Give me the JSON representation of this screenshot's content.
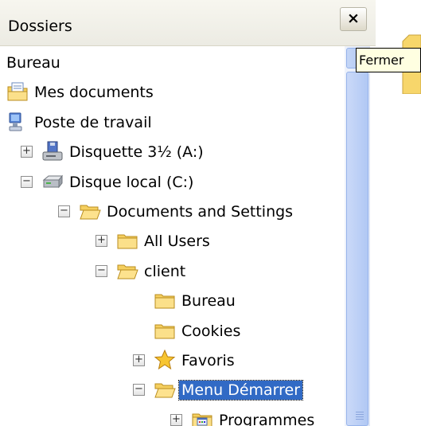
{
  "pane": {
    "title": "Dossiers",
    "close_label": "×"
  },
  "tooltip": {
    "text": "Fermer"
  },
  "tree": [
    {
      "label": "Bureau",
      "indent": 0,
      "expander": "",
      "icon": ""
    },
    {
      "label": "Mes documents",
      "indent": 0,
      "expander": "",
      "icon": "my-documents-icon"
    },
    {
      "label": "Poste de travail",
      "indent": 0,
      "expander": "",
      "icon": "my-computer-icon"
    },
    {
      "label": "Disquette 3½ (A:)",
      "indent": 1,
      "expander": "+",
      "icon": "floppy-drive-icon"
    },
    {
      "label": "Disque local (C:)",
      "indent": 1,
      "expander": "−",
      "icon": "hard-drive-icon"
    },
    {
      "label": "Documents and Settings",
      "indent": 2,
      "expander": "−",
      "icon": "folder-open-icon"
    },
    {
      "label": "All Users",
      "indent": 3,
      "expander": "+",
      "icon": "folder-icon"
    },
    {
      "label": "client",
      "indent": 3,
      "expander": "−",
      "icon": "folder-open-icon"
    },
    {
      "label": "Bureau",
      "indent": 4,
      "expander": "",
      "icon": "folder-icon"
    },
    {
      "label": "Cookies",
      "indent": 4,
      "expander": "",
      "icon": "folder-icon"
    },
    {
      "label": "Favoris",
      "indent": 4,
      "expander": "+",
      "icon": "star-folder-icon"
    },
    {
      "label": "Menu Démarrer",
      "indent": 4,
      "expander": "−",
      "icon": "folder-open-icon",
      "selected": true
    },
    {
      "label": "Programmes",
      "indent": 5,
      "expander": "+",
      "icon": "programs-folder-icon"
    }
  ],
  "colors": {
    "selection": "#316ac5",
    "tooltip_bg": "#ffffe1",
    "header_bg": "#ecebe3"
  }
}
